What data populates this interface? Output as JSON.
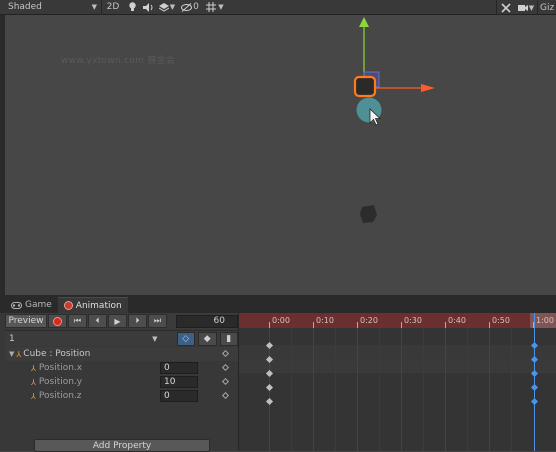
{
  "scene_toolbar": {
    "shading_mode": "Shaded",
    "btn_2d": "2D",
    "fx_count": "0",
    "gizmos_label": "Giz"
  },
  "scene": {
    "watermark": "www.yxtown.com 赛金会"
  },
  "tabs": [
    {
      "label": "Game"
    },
    {
      "label": "Animation"
    }
  ],
  "animation": {
    "preview_label": "Preview",
    "frame": "60",
    "clip_name": "1",
    "group_label": "Cube : Position",
    "properties": [
      {
        "label": "Position.x",
        "value": "0"
      },
      {
        "label": "Position.y",
        "value": "10"
      },
      {
        "label": "Position.z",
        "value": "0"
      }
    ],
    "add_property_label": "Add Property"
  },
  "timeline": {
    "ticks": [
      "0:00",
      "0:10",
      "0:20",
      "0:30",
      "0:40",
      "0:50",
      "1:00"
    ]
  },
  "colors": {
    "record": "#d52b1e",
    "playhead": "#4f93e8",
    "ruler": "#6b2f2f",
    "gizmo_y": "#8fd83a",
    "gizmo_x": "#ff5a2a",
    "selection": "#ff7a1a"
  }
}
